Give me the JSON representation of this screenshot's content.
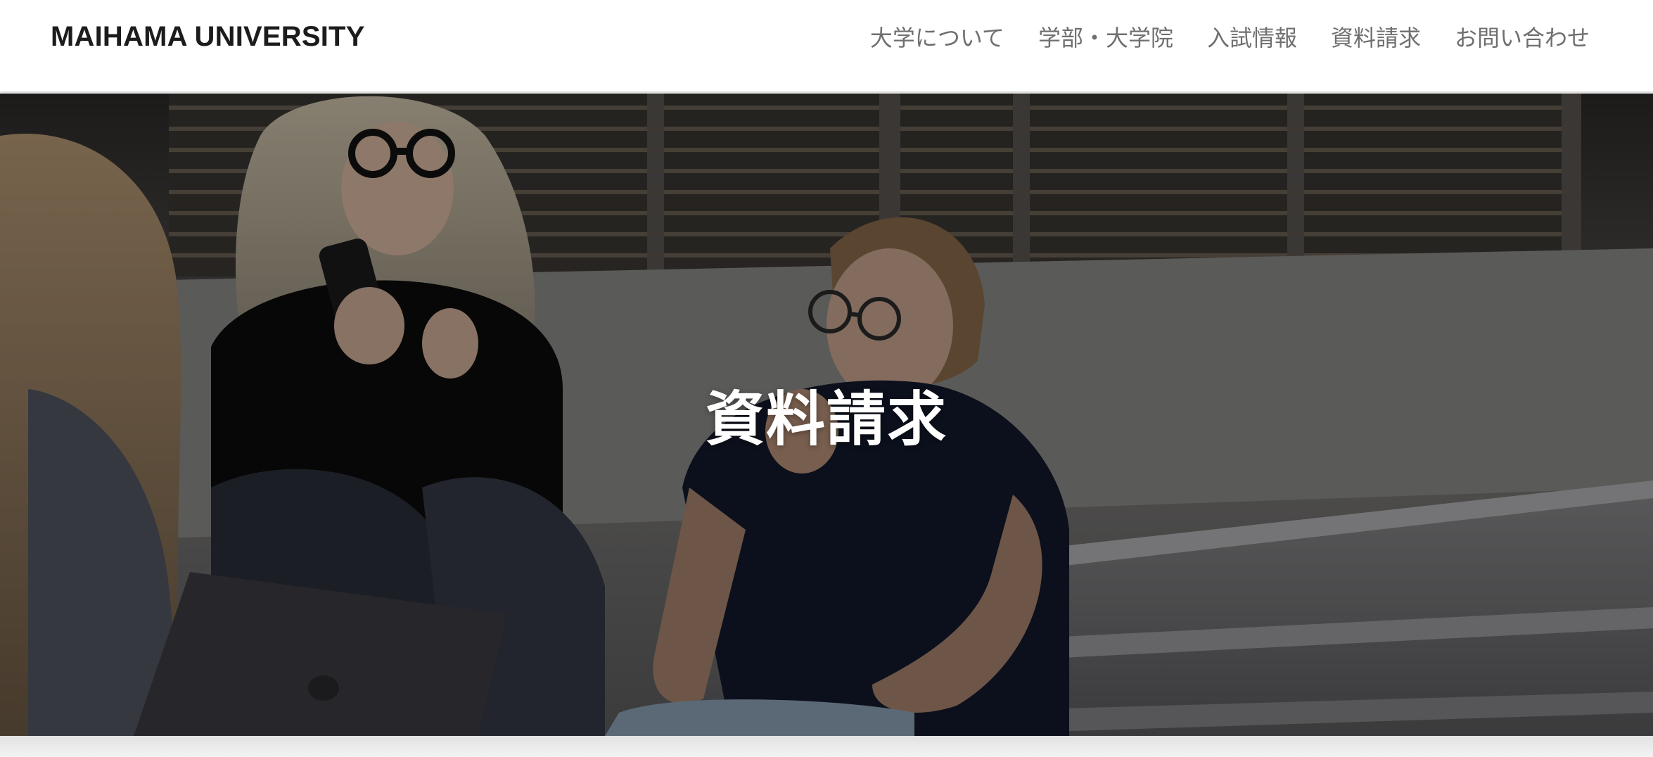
{
  "header": {
    "logo": "MAIHAMA UNIVERSITY",
    "nav": [
      {
        "label": "大学について"
      },
      {
        "label": "学部・大学院"
      },
      {
        "label": "入試情報"
      },
      {
        "label": "資料請求"
      },
      {
        "label": "お問い合わせ"
      }
    ]
  },
  "hero": {
    "title": "資料請求",
    "image": "students-sitting-on-steps-photo"
  },
  "colors": {
    "header_bg": "#ffffff",
    "logo_text": "#1c1c1c",
    "nav_text": "#6f6f6f",
    "hero_title": "#ffffff"
  }
}
